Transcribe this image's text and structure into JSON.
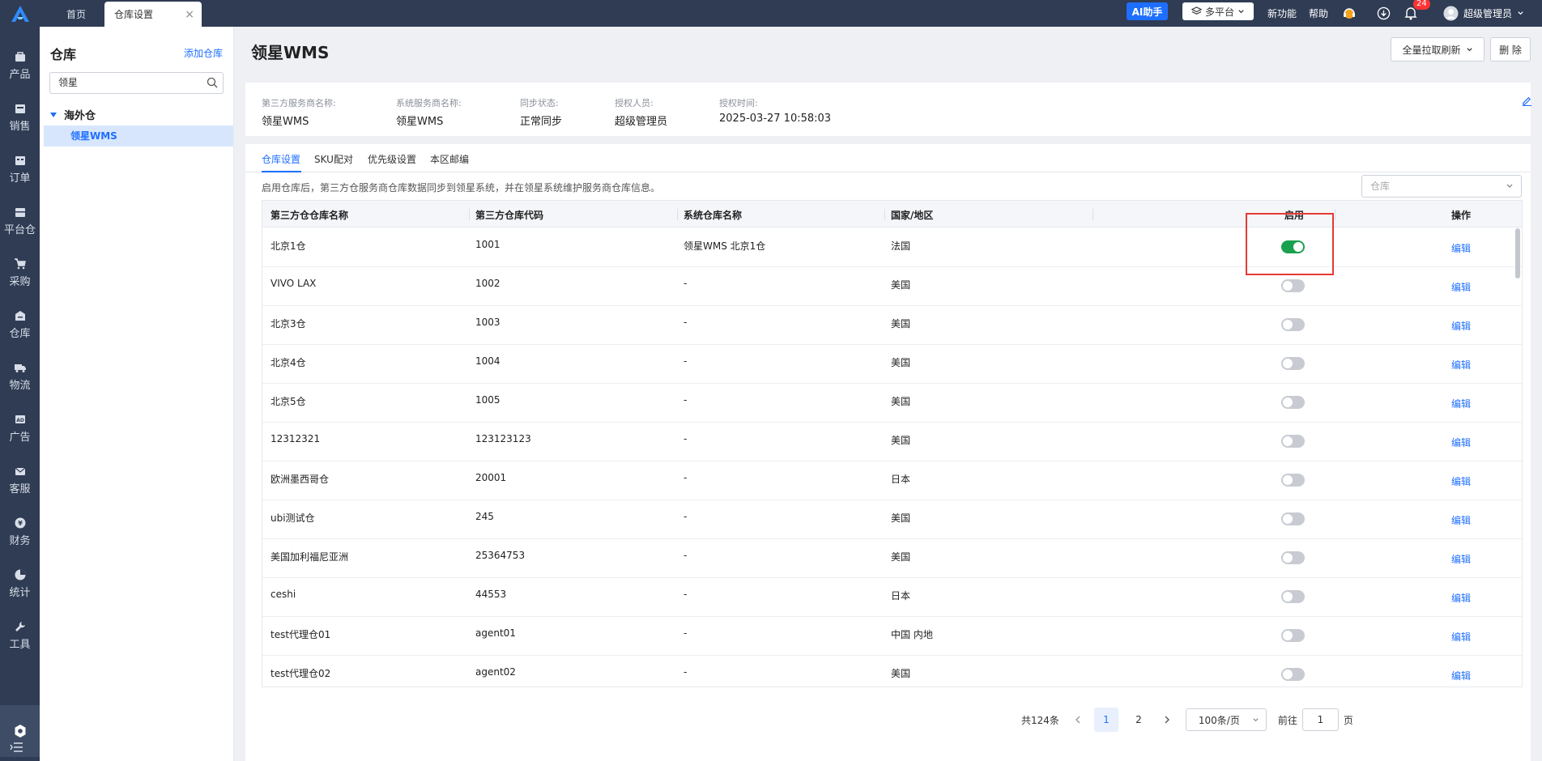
{
  "topbar": {
    "tabs": [
      {
        "label": "首页"
      },
      {
        "label": "仓库设置"
      }
    ],
    "ai_label": "AI助手",
    "platform_label": "多平台",
    "new_feature": "新功能",
    "help": "帮助",
    "notification_count": "24",
    "user_name": "超级管理员"
  },
  "sidebar": {
    "items": [
      {
        "label": "产品",
        "icon": "product-icon"
      },
      {
        "label": "销售",
        "icon": "sales-icon"
      },
      {
        "label": "订单",
        "icon": "order-icon"
      },
      {
        "label": "平台仓",
        "icon": "platform-warehouse-icon"
      },
      {
        "label": "采购",
        "icon": "cart-icon"
      },
      {
        "label": "仓库",
        "icon": "warehouse-icon"
      },
      {
        "label": "物流",
        "icon": "truck-icon"
      },
      {
        "label": "广告",
        "icon": "ad-icon"
      },
      {
        "label": "客服",
        "icon": "mail-icon"
      },
      {
        "label": "财务",
        "icon": "yen-icon"
      },
      {
        "label": "统计",
        "icon": "pie-icon"
      },
      {
        "label": "工具",
        "icon": "wrench-icon"
      }
    ]
  },
  "warehouse_panel": {
    "title": "仓库",
    "add_label": "添加仓库",
    "search_value": "领星",
    "tree_root": "海外仓",
    "tree_child": "领星WMS"
  },
  "main": {
    "title": "领星WMS",
    "refresh_label": "全量拉取刷新",
    "delete_label": "删 除",
    "info": [
      {
        "label": "第三方服务商名称:",
        "value": "领星WMS"
      },
      {
        "label": "系统服务商名称:",
        "value": "领星WMS"
      },
      {
        "label": "同步状态:",
        "value": "正常同步"
      },
      {
        "label": "授权人员:",
        "value": "超级管理员"
      },
      {
        "label": "授权时间:",
        "value": "2025-03-27 10:58:03"
      }
    ],
    "tabs": [
      "仓库设置",
      "SKU配对",
      "优先级设置",
      "本区邮编"
    ],
    "hint": "启用仓库后，第三方仓服务商仓库数据同步到领星系统，并在领星系统维护服务商仓库信息。",
    "warehouse_select_placeholder": "仓库"
  },
  "table": {
    "headers": [
      "第三方仓仓库名称",
      "第三方仓库代码",
      "系统仓库名称",
      "国家/地区",
      "启用",
      "操作"
    ],
    "rows": [
      {
        "name": "北京1仓",
        "code": "1001",
        "sys": "领星WMS 北京1仓",
        "country": "法国",
        "enabled": true,
        "op": "编辑"
      },
      {
        "name": "VIVO LAX",
        "code": "1002",
        "sys": "-",
        "country": "美国",
        "enabled": false,
        "op": "编辑"
      },
      {
        "name": "北京3仓",
        "code": "1003",
        "sys": "-",
        "country": "美国",
        "enabled": false,
        "op": "编辑"
      },
      {
        "name": "北京4仓",
        "code": "1004",
        "sys": "-",
        "country": "美国",
        "enabled": false,
        "op": "编辑"
      },
      {
        "name": "北京5仓",
        "code": "1005",
        "sys": "-",
        "country": "美国",
        "enabled": false,
        "op": "编辑"
      },
      {
        "name": "12312321",
        "code": "123123123",
        "sys": "-",
        "country": "美国",
        "enabled": false,
        "op": "编辑"
      },
      {
        "name": "欧洲墨西哥仓",
        "code": "20001",
        "sys": "-",
        "country": "日本",
        "enabled": false,
        "op": "编辑"
      },
      {
        "name": "ubi测试仓",
        "code": "245",
        "sys": "-",
        "country": "美国",
        "enabled": false,
        "op": "编辑"
      },
      {
        "name": "美国加利福尼亚洲",
        "code": "25364753",
        "sys": "-",
        "country": "美国",
        "enabled": false,
        "op": "编辑"
      },
      {
        "name": "ceshi",
        "code": "44553",
        "sys": "-",
        "country": "日本",
        "enabled": false,
        "op": "编辑"
      },
      {
        "name": "test代理仓01",
        "code": "agent01",
        "sys": "-",
        "country": "中国 内地",
        "enabled": false,
        "op": "编辑"
      },
      {
        "name": "test代理仓02",
        "code": "agent02",
        "sys": "-",
        "country": "美国",
        "enabled": false,
        "op": "编辑"
      }
    ]
  },
  "pagination": {
    "total": "共124条",
    "pages": [
      "1",
      "2"
    ],
    "page_size": "100条/页",
    "goto_prefix": "前往",
    "goto_value": "1",
    "goto_suffix": "页"
  },
  "colors": {
    "accent": "#1e6fff",
    "topbar": "#2f3c54",
    "switch_on": "#1aa14f",
    "highlight": "#e53935"
  }
}
